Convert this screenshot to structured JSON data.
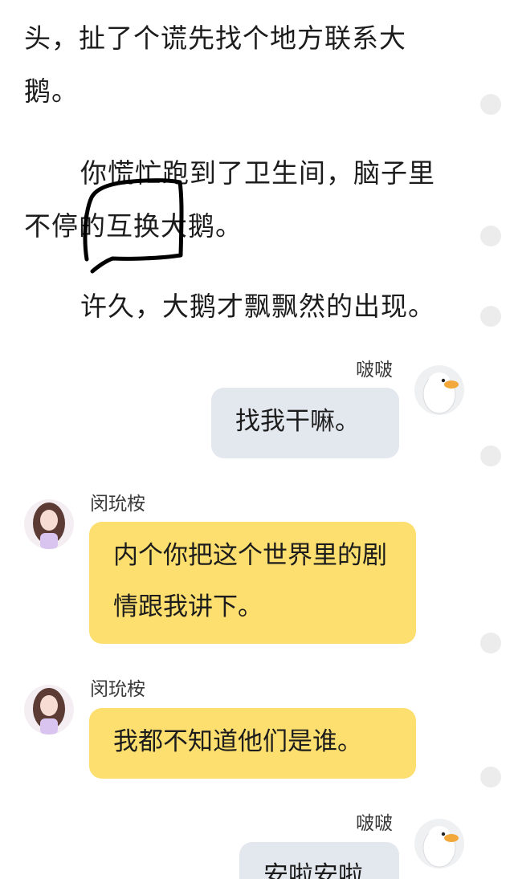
{
  "story": {
    "para1": "头，扯了个谎先找个地方联系大鹅。",
    "para2": "你慌忙跑到了卫生间，脑子里不停的互换大鹅。",
    "para3": "许久，大鹅才飘飘然的出现。"
  },
  "messages": [
    {
      "sender": "啵啵",
      "text": "找我干嘛。",
      "side": "right",
      "avatar": "goose-avatar"
    },
    {
      "sender": "闵玧桉",
      "text": "内个你把这个世界里的剧情跟我讲下。",
      "side": "left",
      "avatar": "girl-avatar"
    },
    {
      "sender": "闵玧桉",
      "text": "我都不知道他们是谁。",
      "side": "left",
      "avatar": "girl-avatar"
    },
    {
      "sender": "啵啵",
      "text": "安啦安啦",
      "side": "right",
      "avatar": "goose-avatar"
    }
  ],
  "colors": {
    "left_bubble": "#fddf6f",
    "right_bubble": "#e3e7ee",
    "scribble": "#000000"
  }
}
